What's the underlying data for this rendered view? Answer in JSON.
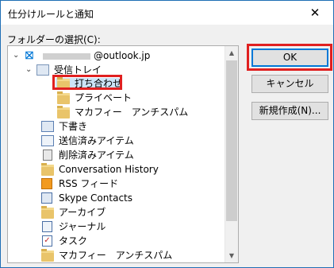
{
  "title": "仕分けルールと通知",
  "close_icon": "close-icon",
  "folder_label": "フォルダーの選択(C):",
  "account": "@outlook.jp",
  "tree": [
    {
      "label": "受信トレイ",
      "icon": "inbox-icon"
    },
    {
      "label": "打ち合わせ",
      "icon": "folder-icon"
    },
    {
      "label": "プライベート",
      "icon": "folder-icon"
    },
    {
      "label": "マカフィー　アンチスパム",
      "icon": "folder-icon"
    },
    {
      "label": "下書き",
      "icon": "draft-icon"
    },
    {
      "label": "送信済みアイテム",
      "icon": "sent-icon"
    },
    {
      "label": "削除済みアイテム",
      "icon": "trash-icon"
    },
    {
      "label": "Conversation History",
      "icon": "folder-icon"
    },
    {
      "label": "RSS フィード",
      "icon": "rss-icon"
    },
    {
      "label": "Skype Contacts",
      "icon": "contacts-icon"
    },
    {
      "label": "アーカイブ",
      "icon": "folder-icon"
    },
    {
      "label": "ジャーナル",
      "icon": "journal-icon"
    },
    {
      "label": "タスク",
      "icon": "task-icon"
    },
    {
      "label": "マカフィー　アンチスパム",
      "icon": "folder-icon"
    }
  ],
  "buttons": {
    "ok": "OK",
    "cancel": "キャンセル",
    "new": "新規作成(N)..."
  }
}
